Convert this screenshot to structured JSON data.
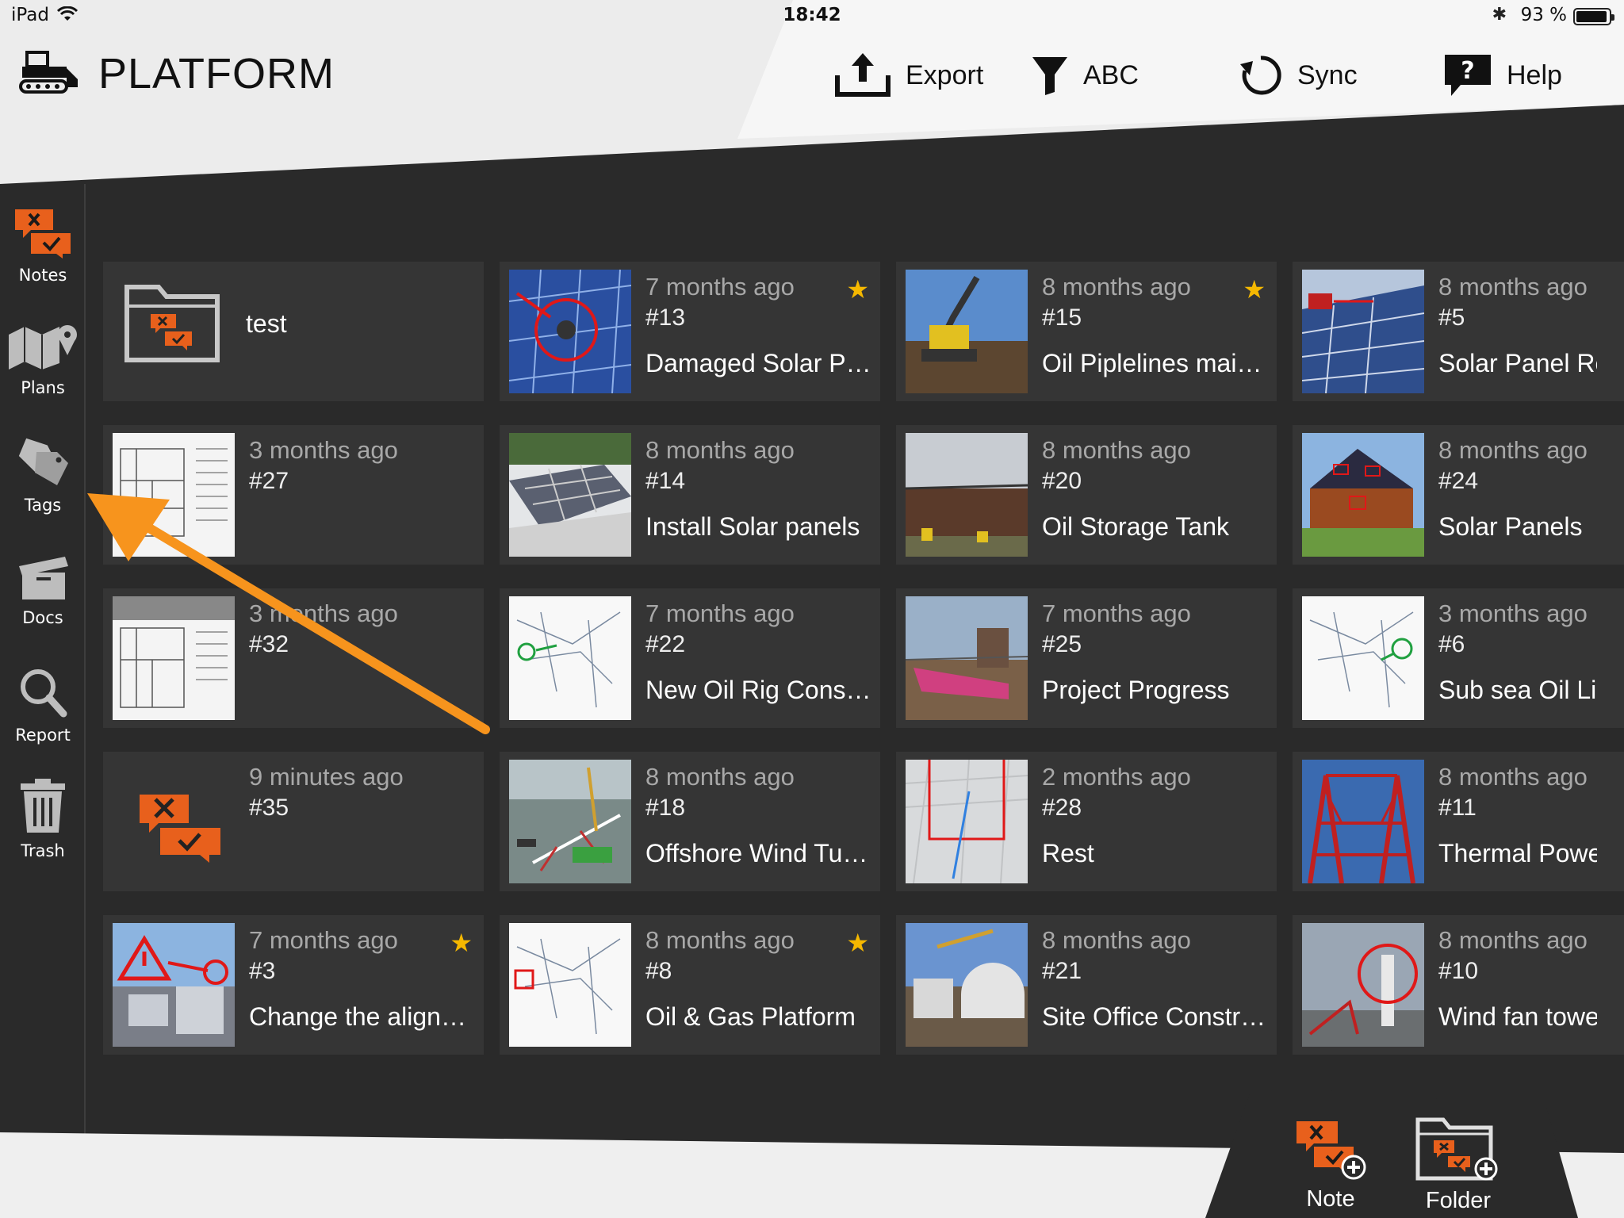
{
  "status_bar": {
    "device": "iPad",
    "time": "18:42",
    "battery": "93 %"
  },
  "app": {
    "title": "PLATFORM"
  },
  "toolbar": {
    "export": "Export",
    "filter": "ABC",
    "sync": "Sync",
    "help": "Help"
  },
  "sidebar": {
    "items": [
      {
        "label": "Notes",
        "icon": "notes-icon"
      },
      {
        "label": "Plans",
        "icon": "plans-icon"
      },
      {
        "label": "Tags",
        "icon": "tags-icon"
      },
      {
        "label": "Docs",
        "icon": "docs-icon"
      },
      {
        "label": "Report",
        "icon": "report-icon"
      },
      {
        "label": "Trash",
        "icon": "trash-icon"
      }
    ]
  },
  "folder": {
    "title": "test"
  },
  "cards": [
    {
      "time": "7 months ago",
      "num": "#13",
      "title": "Damaged Solar Panel",
      "starred": true
    },
    {
      "time": "8 months ago",
      "num": "#15",
      "title": "Oil Piplelines maintenance",
      "starred": true
    },
    {
      "time": "8 months ago",
      "num": "#5",
      "title": "Solar Panel Re",
      "starred": false
    },
    {
      "time": "3 months ago",
      "num": "#27",
      "title": "",
      "starred": false
    },
    {
      "time": "8 months ago",
      "num": "#14",
      "title": "Install Solar panels",
      "starred": false
    },
    {
      "time": "8 months ago",
      "num": "#20",
      "title": "Oil Storage Tank",
      "starred": false
    },
    {
      "time": "8 months ago",
      "num": "#24",
      "title": "Solar Panels",
      "starred": false
    },
    {
      "time": "3 months ago",
      "num": "#32",
      "title": "",
      "starred": false
    },
    {
      "time": "7 months ago",
      "num": "#22",
      "title": "New Oil Rig Construction",
      "starred": false
    },
    {
      "time": "7 months ago",
      "num": "#25",
      "title": "Project Progress",
      "starred": false
    },
    {
      "time": "3 months ago",
      "num": "#6",
      "title": "Sub sea Oil Lir",
      "starred": false
    },
    {
      "time": "9 minutes ago",
      "num": "#35",
      "title": "",
      "starred": false
    },
    {
      "time": "8 months ago",
      "num": "#18",
      "title": "Offshore Wind Turbine",
      "starred": false
    },
    {
      "time": "2 months ago",
      "num": "#28",
      "title": "Rest",
      "starred": false
    },
    {
      "time": "8 months ago",
      "num": "#11",
      "title": "Thermal Powe",
      "starred": false
    },
    {
      "time": "7 months ago",
      "num": "#3",
      "title": "Change the alignment",
      "starred": true
    },
    {
      "time": "8 months ago",
      "num": "#8",
      "title": "Oil & Gas Platform",
      "starred": true
    },
    {
      "time": "8 months ago",
      "num": "#21",
      "title": "Site Office Construction",
      "starred": false
    },
    {
      "time": "8 months ago",
      "num": "#10",
      "title": "Wind fan towe",
      "starred": false
    }
  ],
  "bottom": {
    "note": "Note",
    "folder": "Folder"
  },
  "colors": {
    "accent": "#e8601c",
    "star": "#f5b800",
    "card": "#353535",
    "bg": "#2a2a2a",
    "annotation_arrow": "#f7941d"
  }
}
